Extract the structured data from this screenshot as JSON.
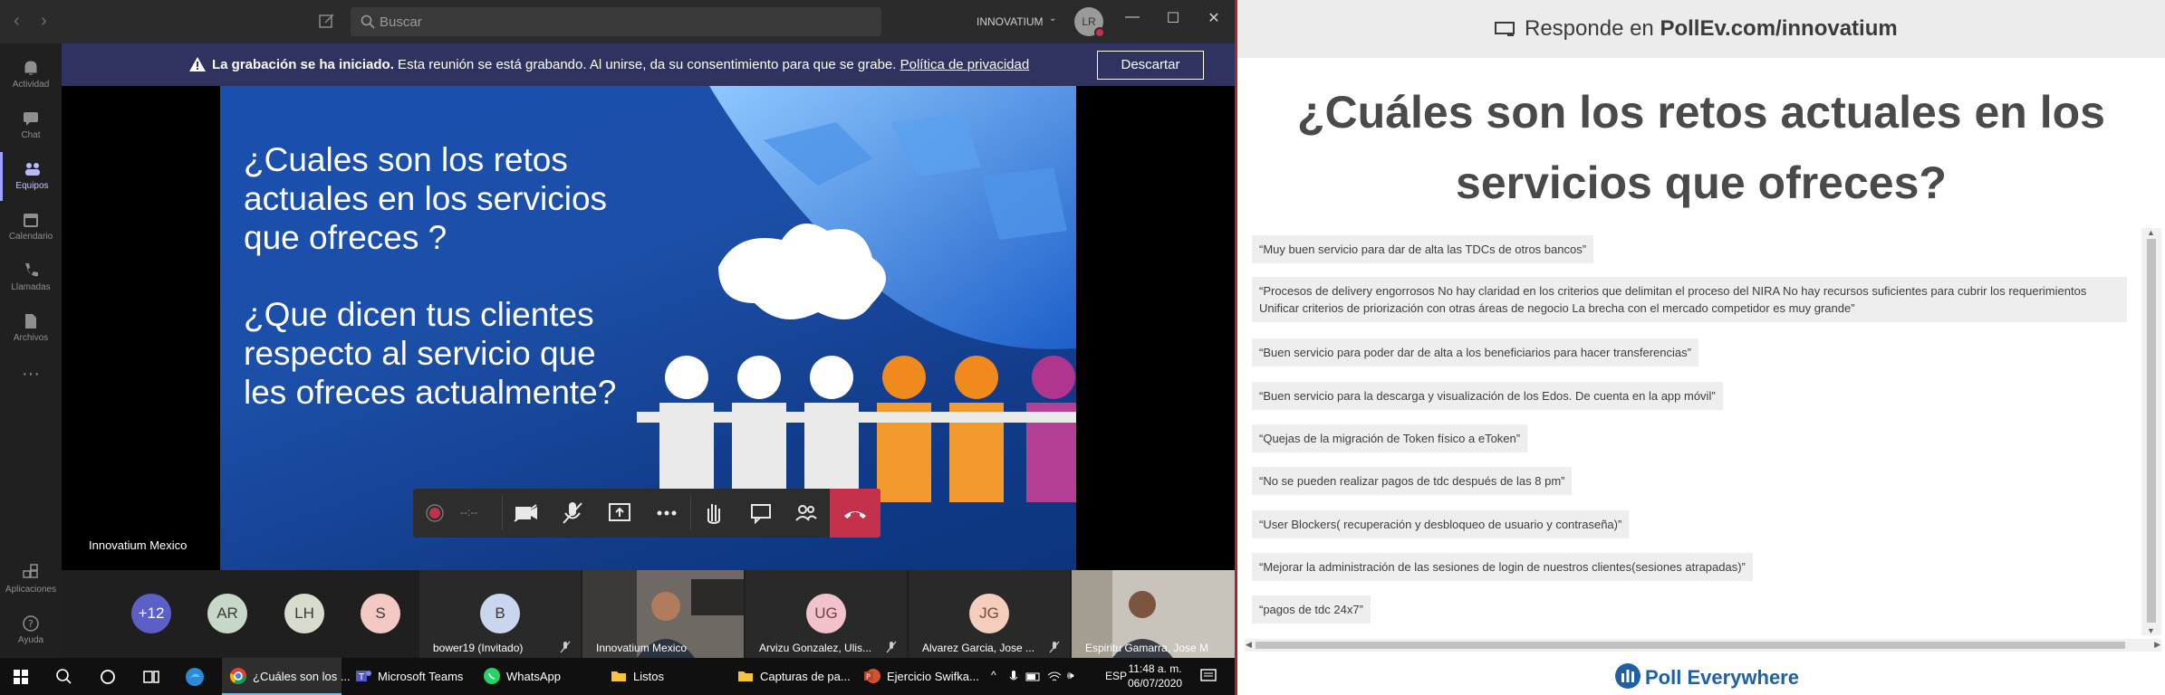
{
  "teams": {
    "search_placeholder": "Buscar",
    "org_name": "INNOVATIUM",
    "me_initials": "LR",
    "rail": [
      {
        "label": "Actividad",
        "icon": "bell-icon"
      },
      {
        "label": "Chat",
        "icon": "chat-icon"
      },
      {
        "label": "Equipos",
        "icon": "teams-icon"
      },
      {
        "label": "Calendario",
        "icon": "calendar-icon"
      },
      {
        "label": "Llamadas",
        "icon": "phone-icon"
      },
      {
        "label": "Archivos",
        "icon": "file-icon"
      },
      {
        "label": "Aplicaciones",
        "icon": "apps-icon"
      },
      {
        "label": "Ayuda",
        "icon": "help-icon"
      }
    ],
    "banner": {
      "bold": "La grabación se ha iniciado.",
      "text": " Esta reunión se está grabando. Al unirse, da su consentimiento para que se grabe. ",
      "link": "Política de privacidad",
      "dismiss": "Descartar"
    },
    "slide": {
      "line1": "¿Cuales son los retos",
      "line2": "actuales en los servicios",
      "line3": "que ofreces ?",
      "line4": "¿Que dicen tus clientes",
      "line5": "respecto al servicio que",
      "line6": "les ofreces actualmente?"
    },
    "presenter_name": "Innovatium Mexico",
    "call_timer": "--:--",
    "gallery": {
      "overflow_count": "+12",
      "mini": [
        {
          "initials": "AR",
          "bg": "#c7d8c8"
        },
        {
          "initials": "LH",
          "bg": "#d8dccf"
        },
        {
          "initials": "S",
          "bg": "#f4c9c4"
        }
      ],
      "tiles": [
        {
          "initials": "B",
          "name": "bower19 (Invitado)",
          "bg": "#c9d6ee"
        },
        {
          "initials": "",
          "name": "Innovatium Mexico",
          "bg": "video"
        },
        {
          "initials": "UG",
          "name": "Arvizu Gonzalez, Ulis...",
          "bg": "#f1c2c9"
        },
        {
          "initials": "JG",
          "name": "Alvarez Garcia, Jose ...",
          "bg": "#f4cdbd"
        },
        {
          "initials": "",
          "name": "Espiritu Gamarra, Jose Mar...",
          "bg": "video"
        }
      ]
    }
  },
  "taskbar": {
    "apps": [
      {
        "label": "¿Cuáles son los ...",
        "icon": "chrome-icon",
        "active": true
      },
      {
        "label": "Microsoft Teams",
        "icon": "teams-app-icon",
        "active": false
      },
      {
        "label": "WhatsApp",
        "icon": "whatsapp-icon",
        "active": false
      },
      {
        "label": "Listos",
        "icon": "folder-icon",
        "active": false
      },
      {
        "label": "Capturas de pa...",
        "icon": "folder-icon",
        "active": false
      },
      {
        "label": "Ejercicio Swifka...",
        "icon": "powerpoint-icon",
        "active": false
      }
    ],
    "lang": "ESP",
    "time": "11:48 a. m.",
    "date": "06/07/2020"
  },
  "poll": {
    "header_prefix": "Responde en",
    "header_url": "PollEv.com/innovatium",
    "title_line1": "¿Cuáles son los retos actuales en los",
    "title_line2": "servicios que ofreces?",
    "responses": [
      "“Muy buen servicio para dar de alta las TDCs de otros bancos”",
      "“Procesos de delivery engorrosos No hay claridad en los criterios que delimitan el proceso del NIRA No hay recursos suficientes para cubrir los requerimientos Unificar criterios de priorización con otras áreas de negocio La brecha con el mercado competidor es muy grande”",
      "“Buen servicio para poder dar de alta a los beneficiarios para hacer transferencias”",
      "“Buen servicio para la descarga y visualización de los Edos. De cuenta en la app móvil”",
      "“Quejas de la migración de Token físico a eToken”",
      "“No se pueden realizar pagos de tdc después de las 8 pm”",
      "“User Blockers( recuperación y desbloqueo de usuario y contraseña)”",
      "“Mejorar la administración de las sesiones de login de nuestros clientes(sesiones atrapadas)”",
      "“pagos de tdc 24x7”"
    ],
    "footer_brand": "Poll Everywhere"
  }
}
